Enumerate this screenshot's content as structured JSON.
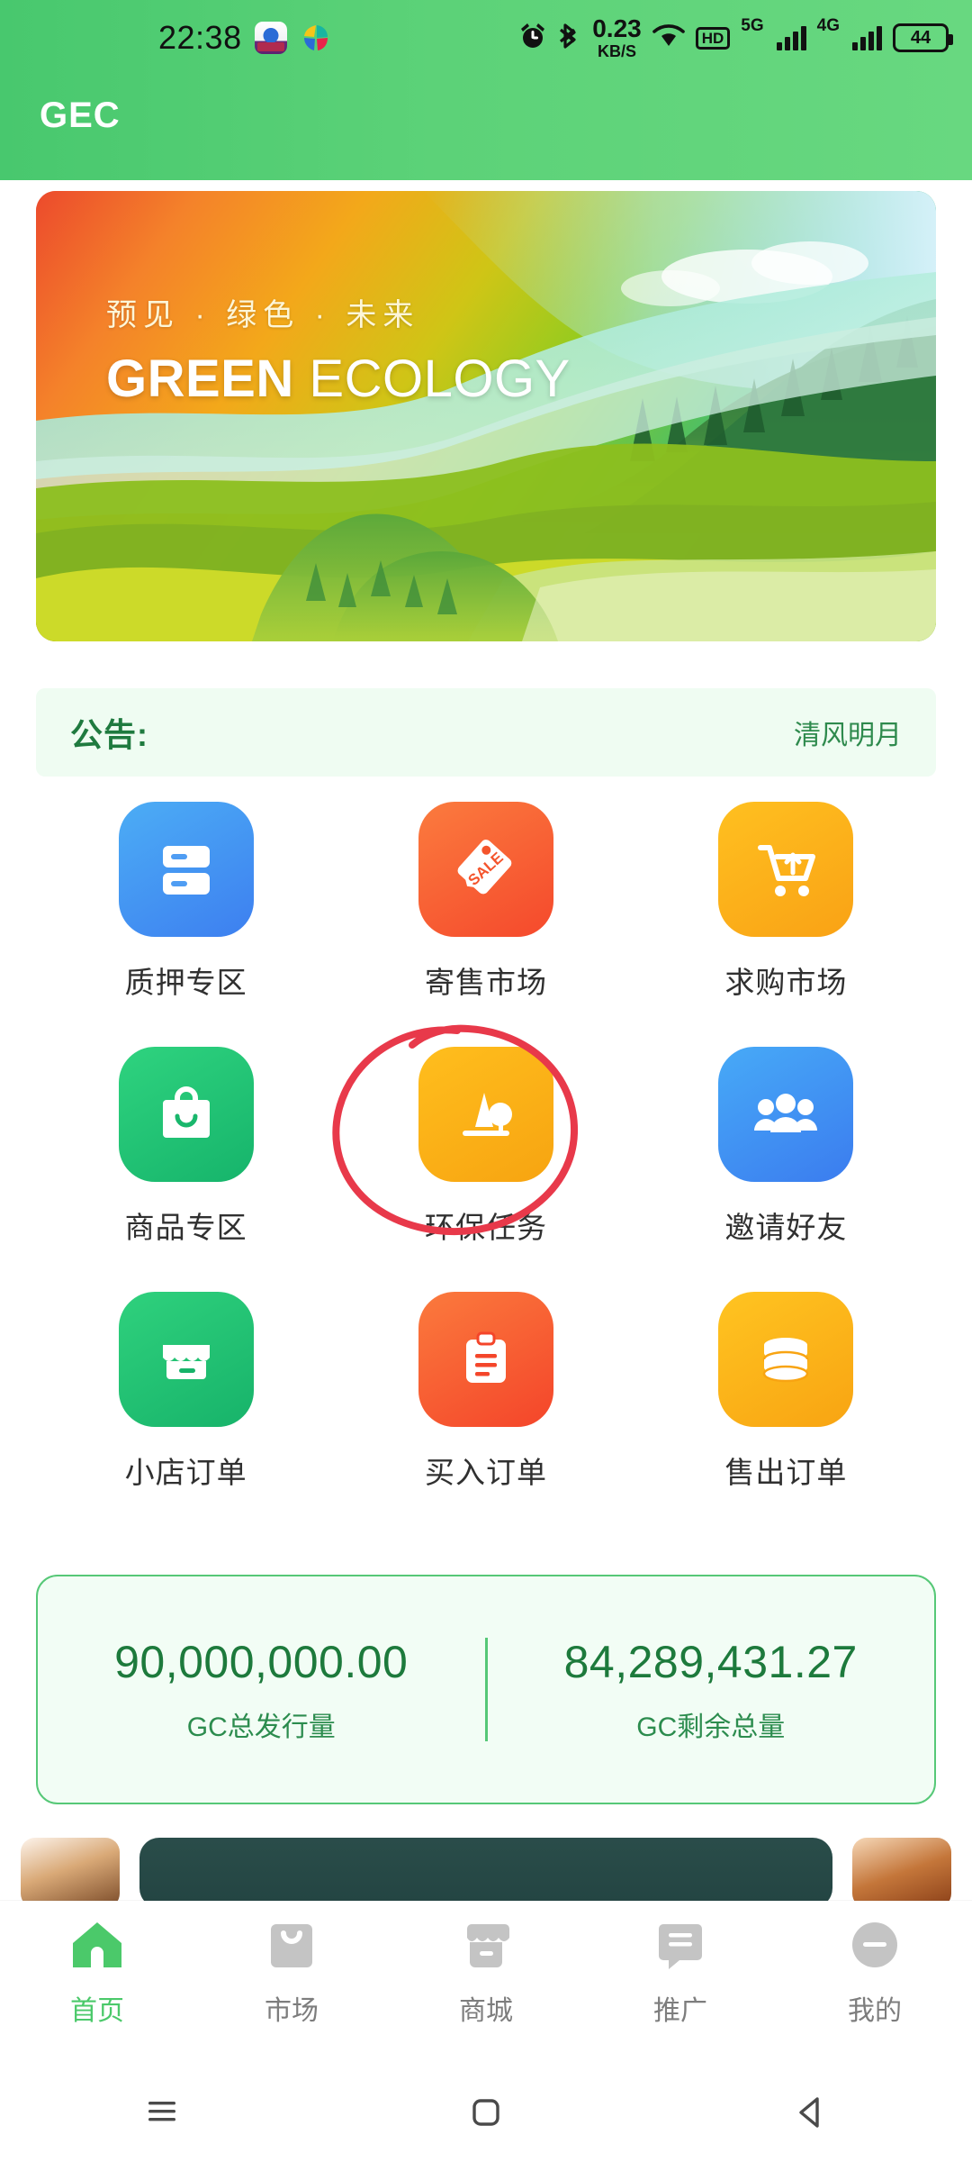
{
  "statusbar": {
    "time": "22:38",
    "icons_left": [
      "netease-app-icon",
      "color-app-icon"
    ],
    "alarm_icon": "alarm-icon",
    "bluetooth_icon": "bluetooth-icon",
    "network_speed_value": "0.23",
    "network_speed_unit": "KB/S",
    "wifi_icon": "wifi-icon",
    "hd_badge": "HD",
    "sim1_gen": "5G",
    "sim2_gen": "4G",
    "battery_level": "44"
  },
  "header": {
    "app_title": "GEC",
    "accent_green": "#4bc96a"
  },
  "banner": {
    "name": "green-ecology-banner",
    "subtitle_cn": "预见 · 绿色 · 未来",
    "title_bold": "GREEN",
    "title_light": "ECOLOGY"
  },
  "announcement": {
    "label": "公告:",
    "value": "清风明月"
  },
  "grid": {
    "items": [
      {
        "label": "质押专区",
        "icon": "server-rack-icon",
        "tile": "t-blue"
      },
      {
        "label": "寄售市场",
        "icon": "sale-tag-icon",
        "tile": "t-orange"
      },
      {
        "label": "求购市场",
        "icon": "shopping-cart-up-icon",
        "tile": "t-yellow"
      },
      {
        "label": "商品专区",
        "icon": "shopping-bag-smile-icon",
        "tile": "t-green"
      },
      {
        "label": "环保任务",
        "icon": "tree-icon",
        "tile": "t-amber"
      },
      {
        "label": "邀请好友",
        "icon": "group-people-icon",
        "tile": "t-blue2"
      },
      {
        "label": "小店订单",
        "icon": "storefront-icon",
        "tile": "t-green2"
      },
      {
        "label": "买入订单",
        "icon": "clipboard-icon",
        "tile": "t-red"
      },
      {
        "label": "售出订单",
        "icon": "coins-stack-icon",
        "tile": "t-gold"
      }
    ],
    "annotation": {
      "name": "red-circle-annotation",
      "color": "#e8394a",
      "target_label": "环保任务"
    }
  },
  "stats": {
    "left": {
      "value": "90,000,000.00",
      "caption": "GC总发行量"
    },
    "right": {
      "value": "84,289,431.27",
      "caption": "GC剩余总量"
    },
    "border_color": "#56c877",
    "text_color": "#1d7a3c"
  },
  "carousel": {
    "name": "product-carousel"
  },
  "bottomnav": {
    "items": [
      {
        "label": "首页",
        "icon": "home-icon",
        "active": true
      },
      {
        "label": "市场",
        "icon": "market-bag-icon",
        "active": false
      },
      {
        "label": "商城",
        "icon": "store-icon",
        "active": false
      },
      {
        "label": "推广",
        "icon": "promote-mail-icon",
        "active": false
      },
      {
        "label": "我的",
        "icon": "profile-face-icon",
        "active": false
      }
    ],
    "active_color": "#4bc96a",
    "inactive_color": "#c4c4c4"
  },
  "androidnav": {
    "recents": "recents-icon",
    "home": "home-square-icon",
    "back": "back-triangle-icon"
  }
}
